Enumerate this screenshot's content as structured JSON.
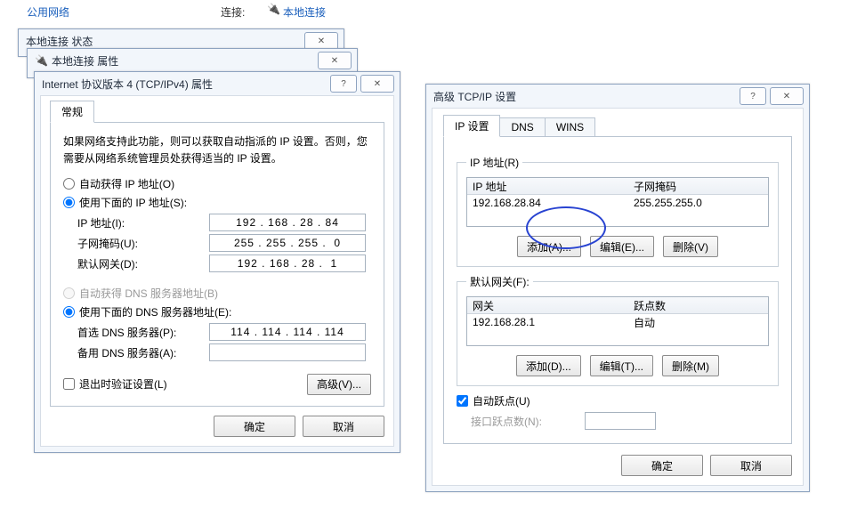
{
  "top": {
    "network_label": "公用网络",
    "conn_label": "连接:",
    "conn_value": "本地连接"
  },
  "win_status_title": "本地连接 状态",
  "win_props_title": "本地连接 属性",
  "ipv4": {
    "title": "Internet 协议版本 4 (TCP/IPv4) 属性",
    "tab_general": "常规",
    "intro": "如果网络支持此功能，则可以获取自动指派的 IP 设置。否则，您需要从网络系统管理员处获得适当的 IP 设置。",
    "opt_auto_ip": "自动获得 IP 地址(O)",
    "opt_manual_ip": "使用下面的 IP 地址(S):",
    "lbl_ip": "IP 地址(I):",
    "lbl_mask": "子网掩码(U):",
    "lbl_gw": "默认网关(D):",
    "val_ip": "192 . 168 . 28 . 84",
    "val_mask": "255 . 255 . 255 .  0",
    "val_gw": "192 . 168 . 28 .  1",
    "opt_auto_dns": "自动获得 DNS 服务器地址(B)",
    "opt_manual_dns": "使用下面的 DNS 服务器地址(E):",
    "lbl_dns1": "首选 DNS 服务器(P):",
    "lbl_dns2": "备用 DNS 服务器(A):",
    "val_dns1": "114 . 114 . 114 . 114",
    "val_dns2": "",
    "chk_validate": "退出时验证设置(L)",
    "btn_adv": "高级(V)...",
    "btn_ok": "确定",
    "btn_cancel": "取消"
  },
  "adv": {
    "title": "高级 TCP/IP 设置",
    "tab_ip": "IP 设置",
    "tab_dns": "DNS",
    "tab_wins": "WINS",
    "grp_ip": "IP 地址(R)",
    "col_ip": "IP 地址",
    "col_mask": "子网掩码",
    "row_ip": "192.168.28.84",
    "row_mask": "255.255.255.0",
    "btn_add_a": "添加(A)...",
    "btn_edit_e": "编辑(E)...",
    "btn_del_v": "删除(V)",
    "grp_gw": "默认网关(F):",
    "col_gw": "网关",
    "col_metric": "跃点数",
    "row_gw": "192.168.28.1",
    "row_metric": "自动",
    "btn_add_d": "添加(D)...",
    "btn_edit_t": "编辑(T)...",
    "btn_del_m": "删除(M)",
    "chk_auto_metric": "自动跃点(U)",
    "lbl_if_metric": "接口跃点数(N):",
    "btn_ok": "确定",
    "btn_cancel": "取消"
  },
  "glyph": {
    "help": "?",
    "close": "✕",
    "usb": "🔌"
  }
}
